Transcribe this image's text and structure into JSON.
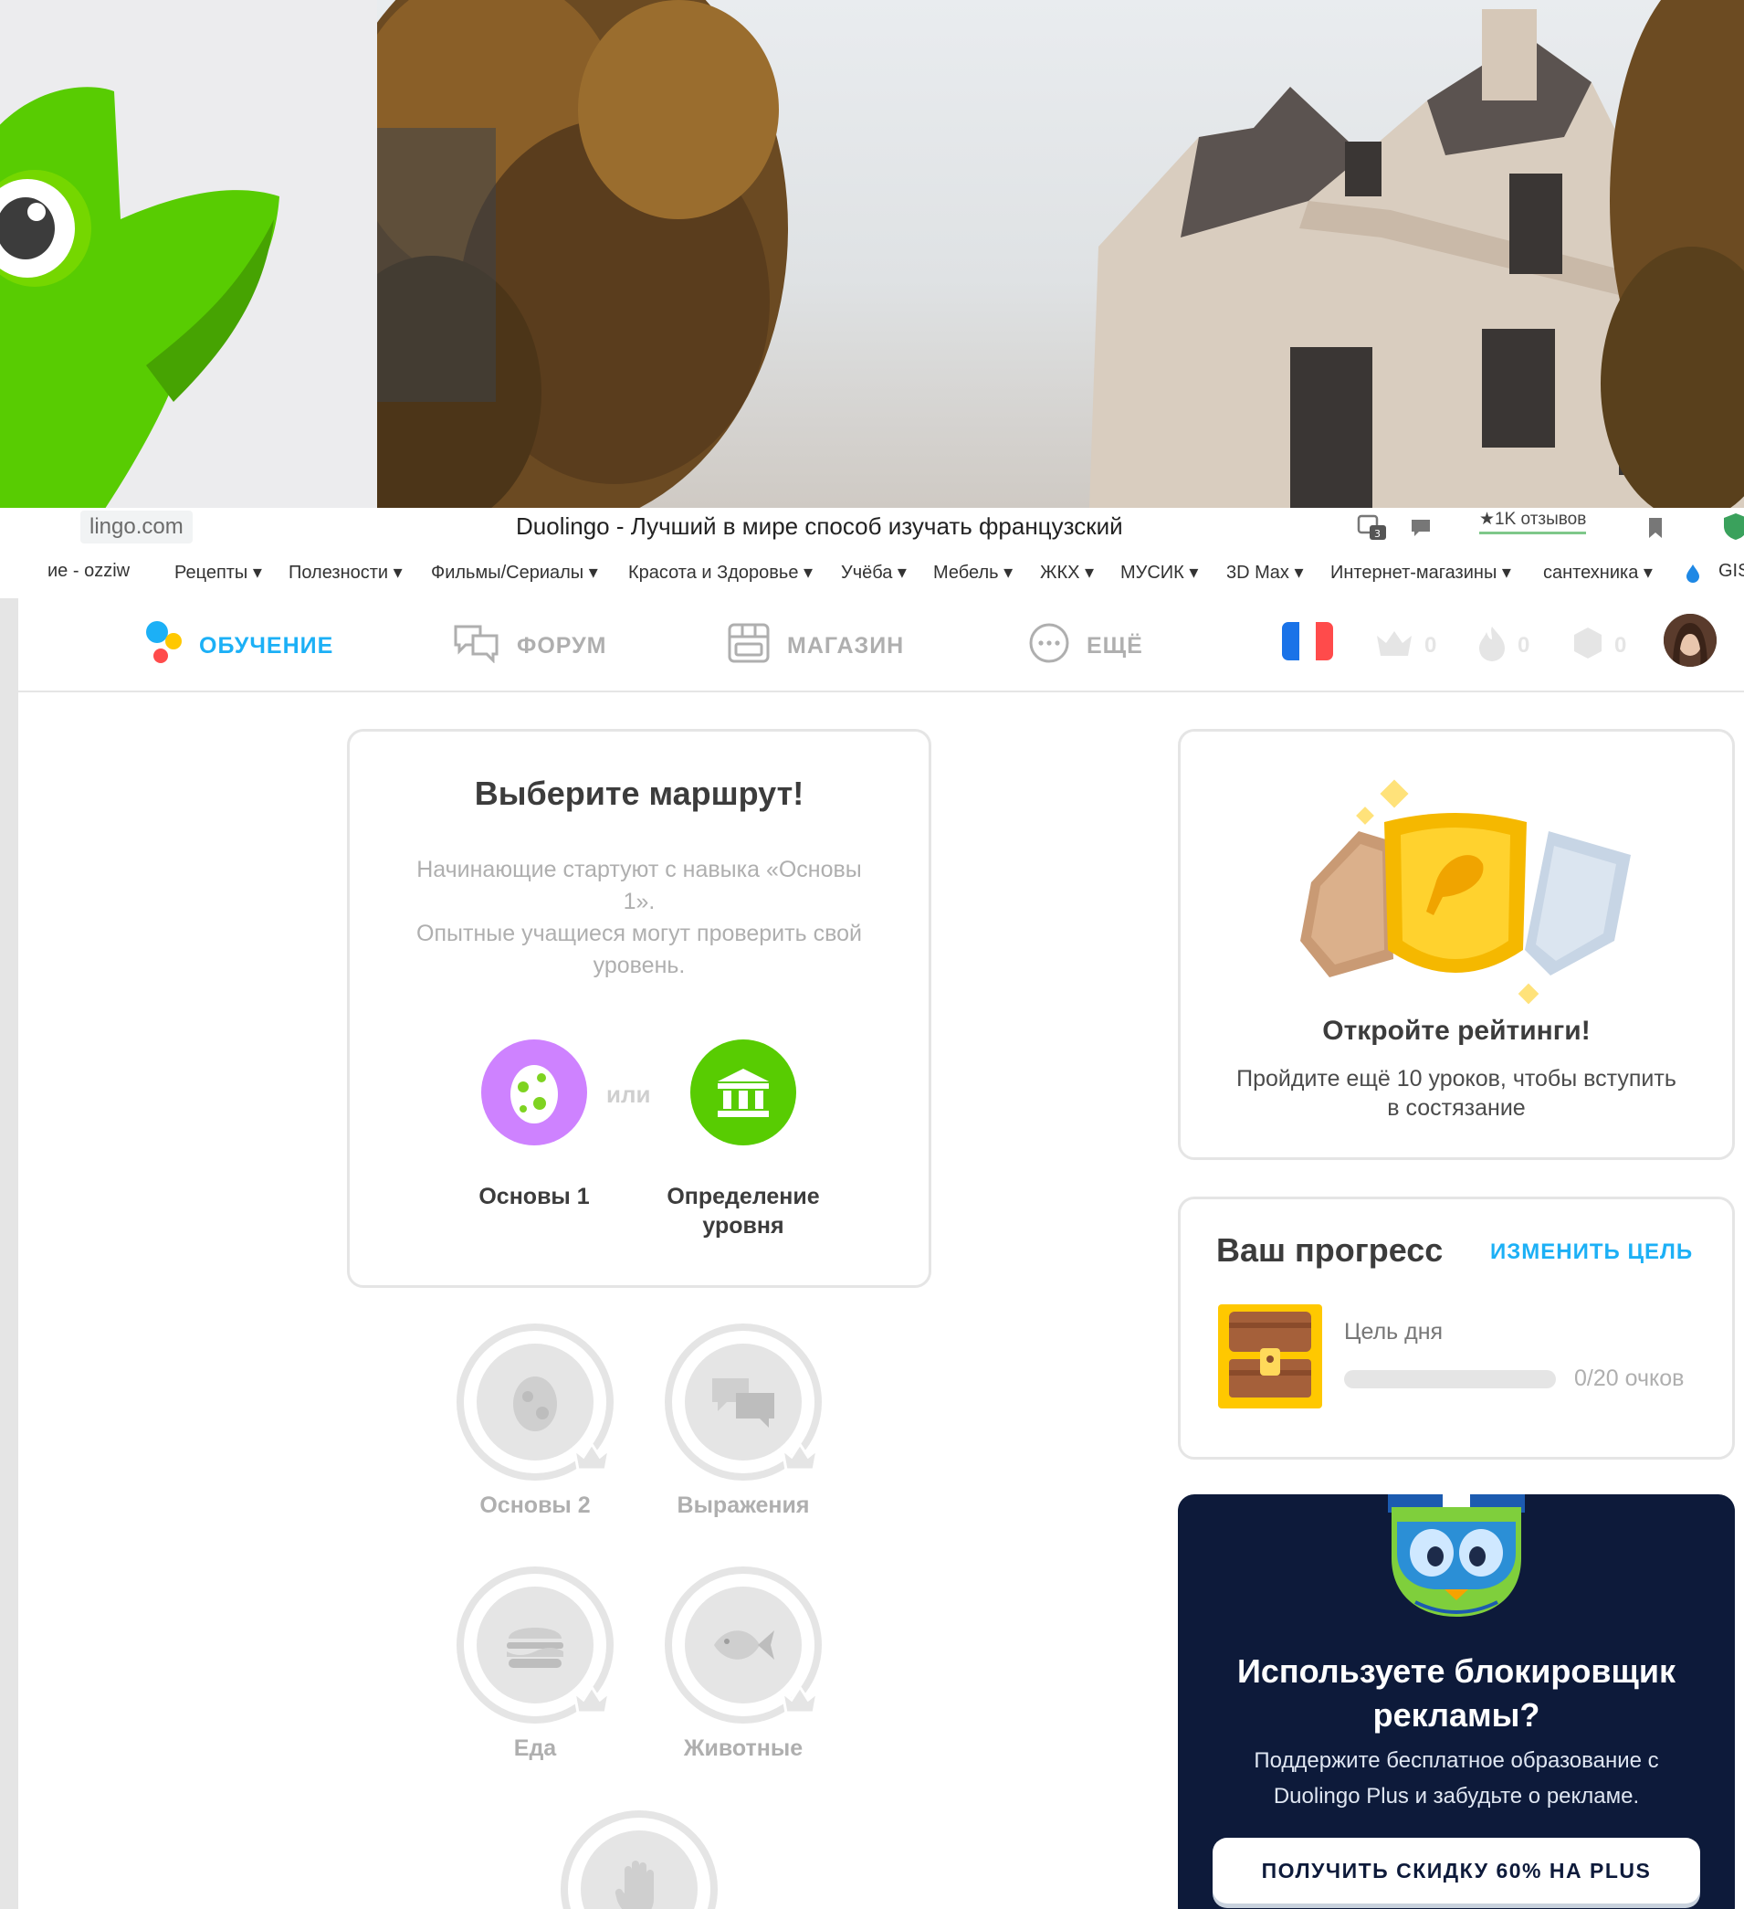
{
  "browser": {
    "url": "lingo.com",
    "tab_title": "Duolingo - Лучший в мире способ изучать французский",
    "reviews_badge": "★1K отзывов",
    "bookmarks": [
      "ие - ozziw",
      "Рецепты ▾",
      "Полезности ▾",
      "Фильмы/Сериалы ▾",
      "Красота и Здоровье ▾",
      "Учёба ▾",
      "Мебель ▾",
      "ЖКХ ▾",
      "МУСИК ▾",
      "3D Max ▾",
      "Интернет-магазины ▾",
      "сантехника ▾",
      "GIS"
    ]
  },
  "nav": {
    "learn": "ОБУЧЕНИЕ",
    "forum": "ФОРУМ",
    "shop": "МАГАЗИН",
    "more": "ЕЩЁ",
    "crowns": "0",
    "streak": "0",
    "gems": "0",
    "colors": {
      "active": "#1cb0f6",
      "inactive": "#afafaf"
    }
  },
  "path_card": {
    "title": "Выберите маршрут!",
    "desc_line1": "Начинающие стартуют с навыка «Основы",
    "desc_line2": "1».",
    "desc_line3": "Опытные учащиеся могут проверить свой",
    "desc_line4": "уровень.",
    "or": "или",
    "option1": "Основы 1",
    "option2_line1": "Определение",
    "option2_line2": "уровня"
  },
  "skills": {
    "s1": "Основы 2",
    "s2": "Выражения",
    "s3": "Еда",
    "s4": "Животные"
  },
  "league": {
    "title": "Откройте рейтинги!",
    "desc_line1": "Пройдите ещё 10 уроков, чтобы вступить",
    "desc_line2": "в состязание"
  },
  "progress": {
    "title": "Ваш прогресс",
    "change_goal": "ИЗМЕНИТЬ ЦЕЛЬ",
    "goal_label": "Цель дня",
    "goal_value": "0/20 очков",
    "goal_fraction": 0
  },
  "ad": {
    "title_line1": "Используете блокировщик",
    "title_line2": "рекламы?",
    "desc_line1": "Поддержите бесплатное образование с",
    "desc_line2": "Duolingo Plus и забудьте о рекламе.",
    "button": "ПОЛУЧИТЬ СКИДКУ 60% НА PLUS"
  }
}
